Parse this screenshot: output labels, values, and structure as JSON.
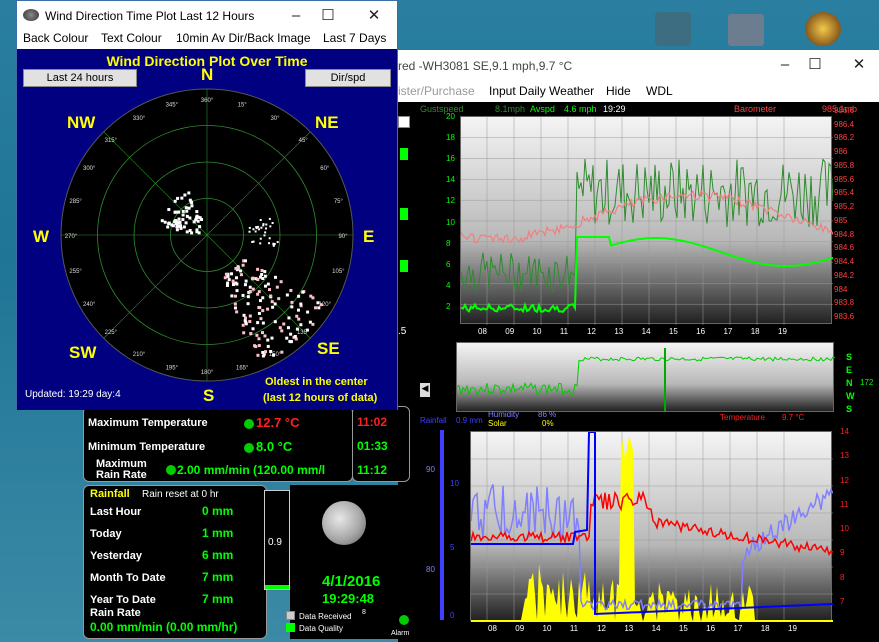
{
  "main_window": {
    "title": "red  -WH3081  SE,9.1 mph,9.7 °C",
    "menu": [
      "ister/Purchase",
      "Input Daily Weather",
      "Hide",
      "WDL"
    ],
    "top_chart": {
      "label_gust": "Gustspeed",
      "val_gust": "8.1mph",
      "label_avspd": "Avspd",
      "val_avspd": "4.6 mph",
      "time": "19:29",
      "label_baro": "Barometer",
      "val_baro": "985.1mb",
      "y_left": [
        "20",
        "18",
        "16",
        "14",
        "12",
        "10",
        "8",
        "6",
        "4",
        "2"
      ],
      "y_right": [
        "986.6",
        "986.4",
        "986.2",
        "986",
        "985.8",
        "985.6",
        "985.4",
        "985.2",
        "985",
        "984.8",
        "984.6",
        "984.4",
        "984.2",
        "984",
        "983.8",
        "983.6"
      ],
      "x_ticks": [
        "08",
        "09",
        "10",
        "11",
        "12",
        "13",
        "14",
        "15",
        "16",
        "17",
        "18",
        "19"
      ]
    },
    "wind_side": [
      "S",
      "E",
      "N",
      "W",
      "S"
    ],
    "wind_side_val": "172",
    "bottom_chart": {
      "label_rain": "Rainfall",
      "val_rain": "0.9 mm",
      "label_humidity": "Humidity",
      "val_humidity": "86 %",
      "label_solar": "Solar",
      "val_solar": "0%",
      "label_temp": "Temperature",
      "val_temp": "9.7 °C",
      "y_left_outer": [
        "90",
        "80"
      ],
      "y_left_inner": [
        "10",
        "5",
        "0"
      ],
      "y_right": [
        "14",
        "13",
        "12",
        "11",
        "10",
        "9",
        "8",
        "7"
      ],
      "x_ticks": [
        "08",
        "09",
        "10",
        "11",
        "12",
        "13",
        "14",
        "15",
        "16",
        "17",
        "18",
        "19"
      ]
    }
  },
  "temps": {
    "max_label": "Maximum Temperature",
    "max_value": "12.7 °C",
    "max_time": "11:02",
    "min_label": "Minimum Temperature",
    "min_value": "8.0 °C",
    "min_time": "01:33",
    "rate_label1": "Maximum",
    "rate_label2": "Rain Rate",
    "rate_value": "2.00 mm/min (120.00 mm/l",
    "rate_time": "11:12"
  },
  "rain": {
    "title": "Rainfall",
    "reset": "Rain reset at 0 hr",
    "rows": [
      {
        "label": "Last Hour",
        "value": "0 mm"
      },
      {
        "label": "Today",
        "value": "1 mm"
      },
      {
        "label": "Yesterday",
        "value": "6 mm"
      },
      {
        "label": "Month To Date",
        "value": "7 mm"
      },
      {
        "label": "Year To Date",
        "value": "7 mm"
      }
    ],
    "rate_label": "Rain Rate",
    "rate_value": "0.00 mm/min (0.00 mm/hr)",
    "gauge_value": "0.9"
  },
  "status": {
    "date": "4/1/2016",
    "time": "19:29:48",
    "data_received": "Data Received",
    "data_received_count": "8",
    "data_quality": "Data Quality",
    "alarm": "Alarm"
  },
  "front_window": {
    "title": "Wind Direction Time Plot Last 12 Hours",
    "menu": [
      "Back Colour",
      "Text Colour",
      "10min Av Dir/Back Image",
      "Last 7 Days"
    ],
    "plot_title": "Wind Direction Plot Over Time",
    "btn_last24": "Last 24 hours",
    "btn_dirspd": "Dir/spd",
    "compass": {
      "N": "N",
      "NE": "NE",
      "E": "E",
      "SE": "SE",
      "S": "S",
      "SW": "SW",
      "W": "W",
      "NW": "NW"
    },
    "degree_labels": [
      "360°",
      "15°",
      "30°",
      "45°",
      "60°",
      "75°",
      "90°",
      "105°",
      "120°",
      "135°",
      "150°",
      "165°",
      "180°",
      "195°",
      "210°",
      "225°",
      "240°",
      "255°",
      "270°",
      "285°",
      "300°",
      "315°",
      "330°",
      "345°"
    ],
    "updated": "Updated: 19:29 day:4",
    "note1": "Oldest in the center",
    "note2": "(last 12 hours of data)"
  },
  "colors": {
    "plot_bg": "#000080",
    "compass_text": "#ffff00",
    "gust": "#2e8b2e",
    "avspd": "#00ff00",
    "baro": "#f08080",
    "rain": "#0000ff",
    "humidity": "#8080ff",
    "solar": "#ffff00",
    "temp": "#ff0000"
  }
}
